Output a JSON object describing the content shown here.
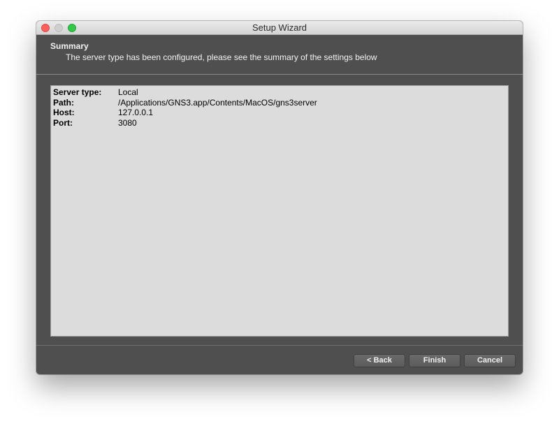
{
  "window": {
    "title": "Setup Wizard"
  },
  "header": {
    "title": "Summary",
    "subtitle": "The server type has been configured, please see the summary of the settings below"
  },
  "summary": {
    "rows": [
      {
        "label": "Server type:",
        "value": "Local"
      },
      {
        "label": "Path:",
        "value": "/Applications/GNS3.app/Contents/MacOS/gns3server"
      },
      {
        "label": "Host:",
        "value": "127.0.0.1"
      },
      {
        "label": "Port:",
        "value": "3080"
      }
    ]
  },
  "buttons": {
    "back": "< Back",
    "finish": "Finish",
    "cancel": "Cancel"
  },
  "colors": {
    "background": "#4f4f4f",
    "summary_bg": "#dcdcdc",
    "close": "#fc605c",
    "zoom": "#34c84a"
  }
}
